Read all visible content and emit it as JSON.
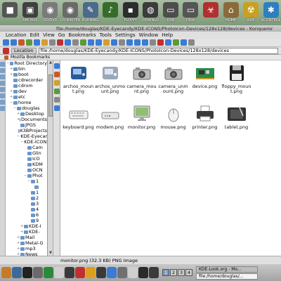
{
  "desktop": {
    "icons": [
      {
        "label": "",
        "color": "#555555",
        "glyph": "■"
      },
      {
        "label": "ARCHOS",
        "color": "#404040",
        "glyph": "▣"
      },
      {
        "label": "CD/DVD",
        "color": "#7a7a7a",
        "glyph": "◉"
      },
      {
        "label": "CD-WRITER",
        "color": "#6a6a6a",
        "glyph": "◉"
      },
      {
        "label": "BURNING",
        "color": "#4c6a8c",
        "glyph": "✎"
      },
      {
        "label": "",
        "color": "#356c2a",
        "glyph": "♪"
      },
      {
        "label": "FLOPPY",
        "color": "#2d2d2d",
        "glyph": "▪"
      },
      {
        "label": "DOWNLO",
        "color": "#3b3b3b",
        "glyph": "◍"
      },
      {
        "label": "DSB",
        "color": "#4d4d4d",
        "glyph": "▭"
      },
      {
        "label": "DISK-",
        "color": "#555555",
        "glyph": "▭"
      },
      {
        "label": "",
        "color": "#b03030",
        "glyph": "☣"
      },
      {
        "label": "HOME",
        "color": "#8a6a3a",
        "glyph": "⌂"
      },
      {
        "label": "KDE",
        "color": "#c9a020",
        "glyph": "☢"
      },
      {
        "label": "KCONTROL",
        "color": "#2f7fc0",
        "glyph": "✱"
      }
    ]
  },
  "window": {
    "title": "file:/home/douglas/KDE-Eyecandy/KDE-ICONS/PhotoIcon-Devices/128x128/devices - Konqueror",
    "menu": [
      "Location",
      "Edit",
      "View",
      "Go",
      "Bookmarks",
      "Tools",
      "Settings",
      "Window",
      "Help"
    ],
    "toolbar_colors": [
      "#3a7bd5",
      "#3a7bd5",
      "#c85a2a",
      "#5a9a3a",
      "#3a7bd5",
      "#d0a030",
      "#888888",
      "#c03030",
      "#3a7bd5",
      "#888888",
      "#5a9a3a",
      "#3a7bd5",
      "#3a7bd5",
      "#d0a030",
      "#3a7bd5",
      "#888888",
      "#3a7bd5",
      "#3a7bd5",
      "#3a7bd5",
      "#888888",
      "#c03030",
      "#3a7bd5",
      "#5a9a3a",
      "#3a7bd5",
      "#888888"
    ],
    "location_label": "Location",
    "location_value": "file:/home/douglas/KDE-Eyecandy/KDE-ICONS/PhotoIcon-Devices/128x128/devices",
    "bookmarks_label": "Mozilla Bookmarks"
  },
  "tree": [
    {
      "indent": 0,
      "label": "Root Directory",
      "exp": "−"
    },
    {
      "indent": 1,
      "label": "bin",
      "exp": "+"
    },
    {
      "indent": 1,
      "label": "boot",
      "exp": "+"
    },
    {
      "indent": 1,
      "label": "cdrecorder",
      "exp": ""
    },
    {
      "indent": 1,
      "label": "cdrom",
      "exp": ""
    },
    {
      "indent": 1,
      "label": "dev",
      "exp": "+"
    },
    {
      "indent": 1,
      "label": "etc",
      "exp": "+"
    },
    {
      "indent": 1,
      "label": "home",
      "exp": "−"
    },
    {
      "indent": 2,
      "label": "douglas",
      "exp": "−"
    },
    {
      "indent": 3,
      "label": "Desktop",
      "exp": "+"
    },
    {
      "indent": 3,
      "label": "Documents",
      "exp": "+"
    },
    {
      "indent": 3,
      "label": "JPGS",
      "exp": ""
    },
    {
      "indent": 3,
      "label": "K3BProjects",
      "exp": ""
    },
    {
      "indent": 3,
      "label": "KDE-Eyecandy",
      "exp": "−"
    },
    {
      "indent": 4,
      "label": "KDE-ICONS",
      "exp": "−"
    },
    {
      "indent": 5,
      "label": "Cam",
      "exp": ""
    },
    {
      "indent": 5,
      "label": "Glin",
      "exp": ""
    },
    {
      "indent": 5,
      "label": "IcO",
      "exp": ""
    },
    {
      "indent": 5,
      "label": "KDM",
      "exp": ""
    },
    {
      "indent": 5,
      "label": "OCN",
      "exp": ""
    },
    {
      "indent": 5,
      "label": "Phot",
      "exp": "−"
    },
    {
      "indent": 6,
      "label": "1",
      "exp": "−"
    },
    {
      "indent": 7,
      "label": "",
      "exp": ""
    },
    {
      "indent": 6,
      "label": "1",
      "exp": ""
    },
    {
      "indent": 6,
      "label": "2",
      "exp": ""
    },
    {
      "indent": 6,
      "label": "3",
      "exp": ""
    },
    {
      "indent": 6,
      "label": "4",
      "exp": ""
    },
    {
      "indent": 6,
      "label": "6",
      "exp": ""
    },
    {
      "indent": 6,
      "label": "9",
      "exp": ""
    },
    {
      "indent": 4,
      "label": "KDE-I",
      "exp": "+"
    },
    {
      "indent": 4,
      "label": "KDE-",
      "exp": "+"
    },
    {
      "indent": 3,
      "label": "Mail",
      "exp": "+"
    },
    {
      "indent": 3,
      "label": "Metal-G",
      "exp": "+"
    },
    {
      "indent": 3,
      "label": "mp3",
      "exp": "+"
    },
    {
      "indent": 3,
      "label": "News",
      "exp": "+"
    },
    {
      "indent": 3,
      "label": "OSS-SRC",
      "exp": "+"
    }
  ],
  "files": [
    {
      "name": "archos_mount.png",
      "kind": "archos"
    },
    {
      "name": "archos_unmount.png",
      "kind": "archos2"
    },
    {
      "name": "camera_mount.png",
      "kind": "camera"
    },
    {
      "name": "camera_unmount.png",
      "kind": "camera"
    },
    {
      "name": "device.png",
      "kind": "board"
    },
    {
      "name": "floppy_mount.png",
      "kind": "floppy"
    },
    {
      "name": "",
      "kind": "empty"
    },
    {
      "name": "keyboard.png",
      "kind": "keyboard"
    },
    {
      "name": "modem.png",
      "kind": "modem"
    },
    {
      "name": "monitor.png",
      "kind": "monitor"
    },
    {
      "name": "mouse.png",
      "kind": "mouse"
    },
    {
      "name": "printer.png",
      "kind": "printer"
    },
    {
      "name": "tablet.png",
      "kind": "tablet"
    }
  ],
  "status": "monitor.png (32.3 KB) PNG Image",
  "taskbar": {
    "pager": [
      "1",
      "2",
      "3",
      "4"
    ],
    "active_page": 1,
    "tasks": [
      {
        "label": "KDE-Look.org - Mo...",
        "active": false
      },
      {
        "label": "file:/home/douglas/...",
        "active": true
      }
    ],
    "launcher_colors": [
      "#c77a2a",
      "#3a6a9a",
      "#222222",
      "#6a6a6a",
      "#2a8a3a",
      "#cfcfcf",
      "#3a3a3a",
      "#c03030",
      "#d9a020",
      "#3a3a3a",
      "#3a7bd5",
      "#707070",
      "#cfcfcf",
      "#2a2a2a",
      "#3a3a3a"
    ]
  }
}
